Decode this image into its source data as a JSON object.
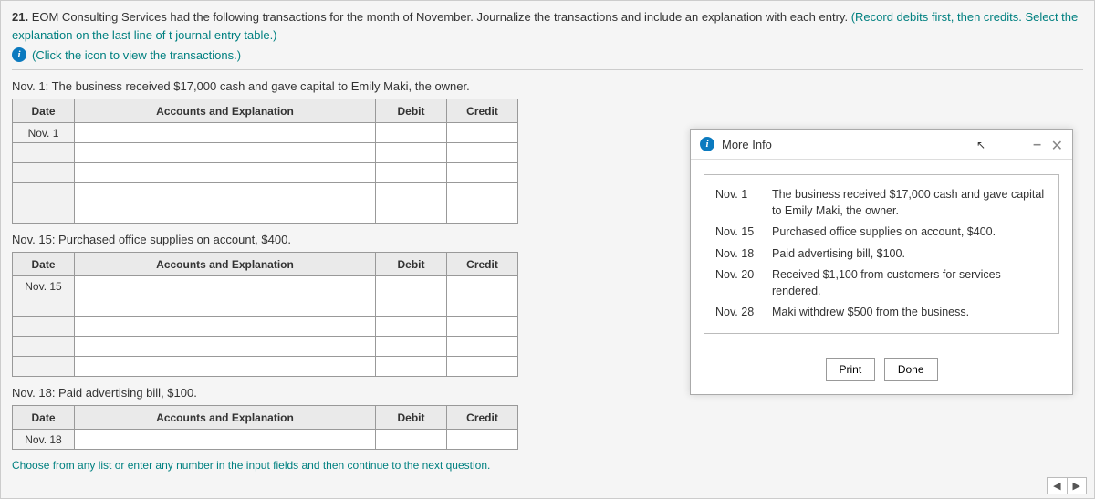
{
  "question": {
    "number": "21.",
    "body": "EOM Consulting Services had the following transactions for the month of November. Journalize the transactions and include an explanation with each entry.",
    "parenInstr": "(Record debits first, then credits. Select the explanation on the last line of t journal entry table.)",
    "clickIcon": "(Click the icon to view the transactions.)"
  },
  "headers": {
    "date": "Date",
    "acct": "Accounts and Explanation",
    "debit": "Debit",
    "credit": "Credit"
  },
  "entries": [
    {
      "label": "Nov. 1: The business received $17,000 cash and gave capital to Emily Maki, the owner.",
      "dateCell": "Nov. 1"
    },
    {
      "label": "Nov. 15: Purchased office supplies on account, $400.",
      "dateCell": "Nov. 15"
    },
    {
      "label": "Nov. 18: Paid advertising bill, $100.",
      "dateCell": "Nov. 18",
      "short": true
    }
  ],
  "hint": "Choose from any list or enter any number in the input fields and then continue to the next question.",
  "popup": {
    "title": "More Info",
    "buttons": {
      "print": "Print",
      "done": "Done"
    },
    "transactions": [
      {
        "date": "Nov. 1",
        "desc": "The business received $17,000 cash and gave capital to Emily Maki, the owner."
      },
      {
        "date": "Nov. 15",
        "desc": "Purchased office supplies on account, $400."
      },
      {
        "date": "Nov. 18",
        "desc": "Paid advertising bill, $100."
      },
      {
        "date": "Nov. 20",
        "desc": "Received $1,100 from customers for services rendered."
      },
      {
        "date": "Nov. 28",
        "desc": "Maki withdrew $500 from the business."
      }
    ]
  }
}
